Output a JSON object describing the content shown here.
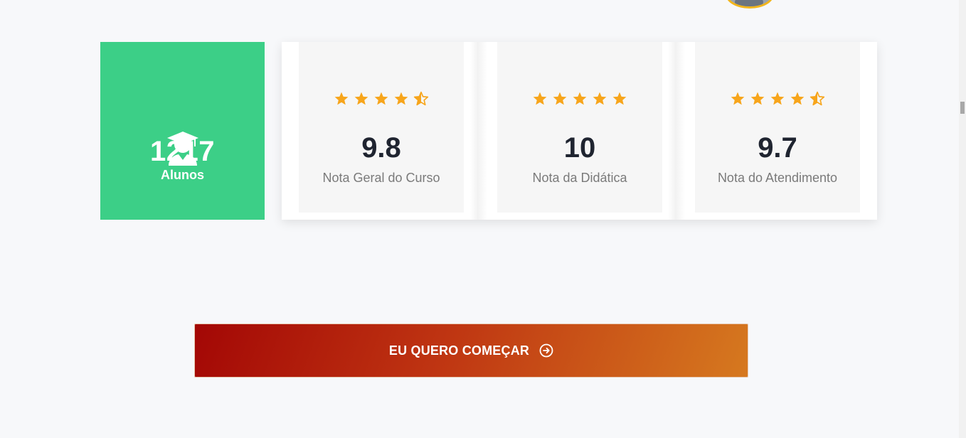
{
  "stats": {
    "students_count": "1217",
    "students_label": "Alunos"
  },
  "ratings": [
    {
      "score": "9.8",
      "label": "Nota Geral do Curso",
      "stars": 4.5
    },
    {
      "score": "10",
      "label": "Nota da Didática",
      "stars": 5
    },
    {
      "score": "9.7",
      "label": "Nota do Atendimento",
      "stars": 4.5
    }
  ],
  "cta": {
    "label": "EU QUERO COMEÇAR",
    "icon": "arrow-right-circle-icon"
  },
  "colors": {
    "students_card": "#3ccf87",
    "star": "#f7a51b",
    "cta_start": "#a30705",
    "cta_end": "#d6791f"
  }
}
